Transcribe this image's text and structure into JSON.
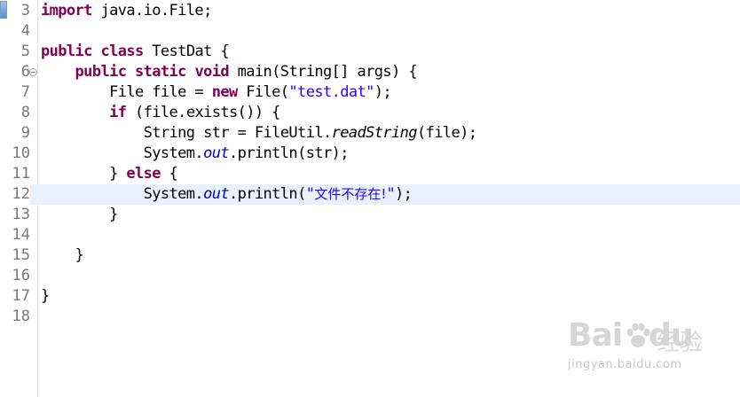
{
  "editor": {
    "lines": [
      {
        "num": "3",
        "tokens": [
          {
            "t": "import",
            "c": "kw"
          },
          {
            "t": " java.io.File;",
            "c": ""
          }
        ]
      },
      {
        "num": "4",
        "tokens": []
      },
      {
        "num": "5",
        "tokens": [
          {
            "t": "public",
            "c": "kw"
          },
          {
            "t": " ",
            "c": ""
          },
          {
            "t": "class",
            "c": "kw"
          },
          {
            "t": " TestDat {",
            "c": ""
          }
        ]
      },
      {
        "num": "6",
        "fold": true,
        "tokens": [
          {
            "t": "    ",
            "c": ""
          },
          {
            "t": "public",
            "c": "kw"
          },
          {
            "t": " ",
            "c": ""
          },
          {
            "t": "static",
            "c": "kw"
          },
          {
            "t": " ",
            "c": ""
          },
          {
            "t": "void",
            "c": "kw"
          },
          {
            "t": " main(String[] args) {",
            "c": ""
          }
        ]
      },
      {
        "num": "7",
        "tokens": [
          {
            "t": "        File file = ",
            "c": ""
          },
          {
            "t": "new",
            "c": "kw"
          },
          {
            "t": " File(",
            "c": ""
          },
          {
            "t": "\"test.dat\"",
            "c": "str"
          },
          {
            "t": ");",
            "c": ""
          }
        ]
      },
      {
        "num": "8",
        "tokens": [
          {
            "t": "        ",
            "c": ""
          },
          {
            "t": "if",
            "c": "kw"
          },
          {
            "t": " (file.exists()) {",
            "c": ""
          }
        ]
      },
      {
        "num": "9",
        "tokens": [
          {
            "t": "            String str = FileUtil.",
            "c": ""
          },
          {
            "t": "readString",
            "c": "static-m"
          },
          {
            "t": "(file);",
            "c": ""
          }
        ]
      },
      {
        "num": "10",
        "tokens": [
          {
            "t": "            System.",
            "c": ""
          },
          {
            "t": "out",
            "c": "field"
          },
          {
            "t": ".println(str);",
            "c": ""
          }
        ]
      },
      {
        "num": "11",
        "tokens": [
          {
            "t": "        } ",
            "c": ""
          },
          {
            "t": "else",
            "c": "kw"
          },
          {
            "t": " {",
            "c": ""
          }
        ]
      },
      {
        "num": "12",
        "highlight": true,
        "tokens": [
          {
            "t": "            System.",
            "c": ""
          },
          {
            "t": "out",
            "c": "field"
          },
          {
            "t": ".println(",
            "c": ""
          },
          {
            "t": "\"",
            "c": "str"
          },
          {
            "t": "文件不存在!",
            "c": "str cjk"
          },
          {
            "t": "\"",
            "c": "str"
          },
          {
            "t": ");",
            "c": ""
          }
        ]
      },
      {
        "num": "13",
        "tokens": [
          {
            "t": "        }",
            "c": ""
          }
        ]
      },
      {
        "num": "14",
        "tokens": []
      },
      {
        "num": "15",
        "tokens": [
          {
            "t": "    }",
            "c": ""
          }
        ]
      },
      {
        "num": "16",
        "tokens": []
      },
      {
        "num": "17",
        "tokens": [
          {
            "t": "}",
            "c": ""
          }
        ]
      },
      {
        "num": "18",
        "tokens": []
      }
    ],
    "colors": {
      "keyword": "#7f0055",
      "string": "#2a00ff",
      "field": "#0000c0",
      "line_number": "#787878",
      "current_line": "#e8f2fe"
    }
  },
  "watermark": {
    "logo": "Bai",
    "logo_tail": "du",
    "chinese": "经验",
    "url": "jingyan.baidu.com"
  }
}
